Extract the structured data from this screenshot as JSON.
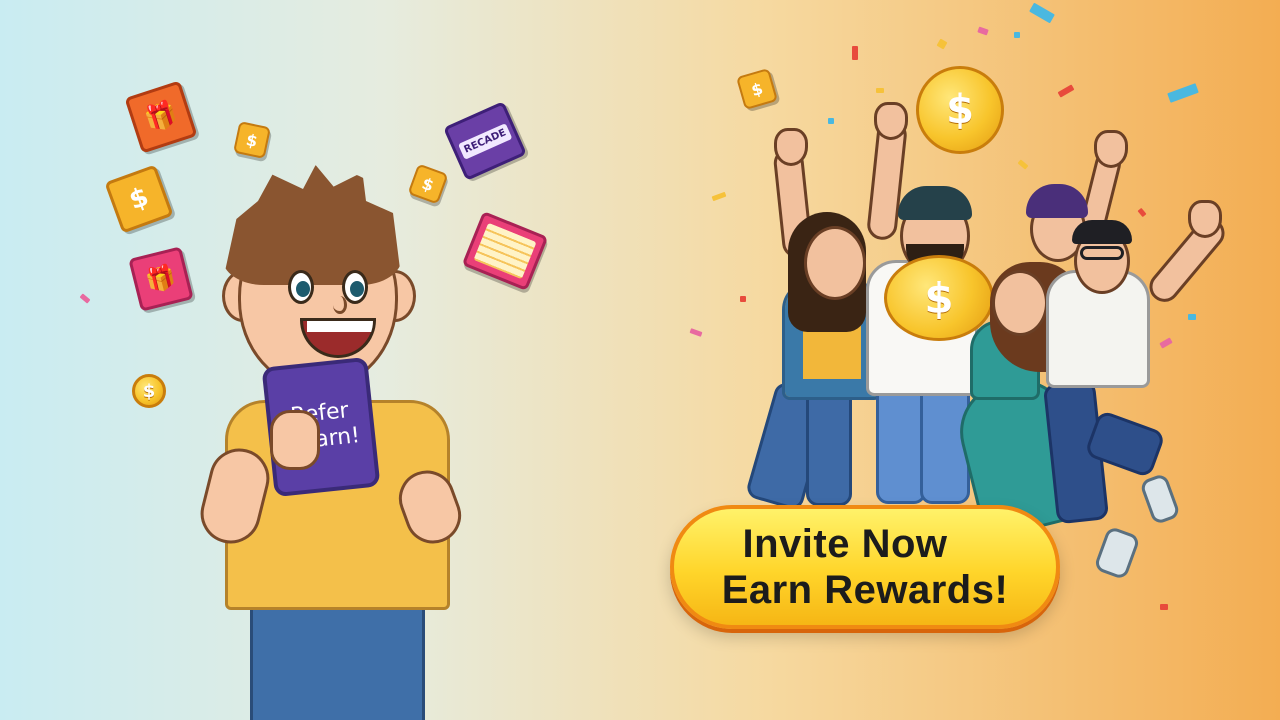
{
  "phone": {
    "line1": "Refer",
    "line2": "&earn!"
  },
  "cta": {
    "line1": "Invite Now",
    "line2": "Earn Rewards!"
  },
  "card_text": "RECADE",
  "coin_symbol": "$",
  "colors": {
    "background_left": "#c9ecf2",
    "background_right": "#f3ad52",
    "cta_fill": "#ffd52a",
    "cta_border": "#f08a12",
    "phone": "#5a3fa6",
    "shirt": "#f4c04a",
    "coin": "#f8c52c"
  }
}
